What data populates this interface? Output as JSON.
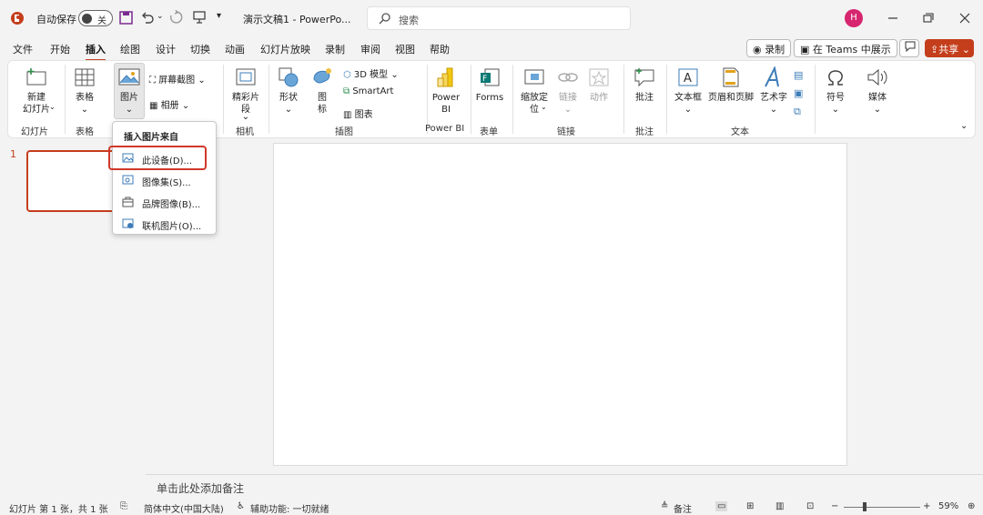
{
  "titlebar": {
    "autosave_label": "自动保存",
    "autosave_state": "关",
    "doc_title": "演示文稿1  -  PowerPo...",
    "search_placeholder": "搜索",
    "avatar_initial": "H"
  },
  "tabs": [
    "文件",
    "开始",
    "插入",
    "绘图",
    "设计",
    "切换",
    "动画",
    "幻灯片放映",
    "录制",
    "审阅",
    "视图",
    "帮助"
  ],
  "active_tab": "插入",
  "header_buttons": {
    "record": "录制",
    "teams": "在 Teams 中展示",
    "share": "共享"
  },
  "ribbon": {
    "new_slide": "新建\n幻灯片",
    "table": "表格",
    "picture": "图片",
    "screenshot": "屏幕截图",
    "album": "相册",
    "cameo": "精彩片\n段",
    "shapes": "形状",
    "icons": "图\n标",
    "model3d": "3D 模型",
    "smartart": "SmartArt",
    "chart": "图表",
    "powerbi": "Power\nBI",
    "forms": "Forms",
    "zoom": "缩放定\n位",
    "link": "链接",
    "action": "动作",
    "comment": "批注",
    "textbox": "文本框",
    "header_footer": "页眉和页脚",
    "wordart": "艺术字",
    "symbol": "符号",
    "media": "媒体",
    "groups": {
      "slides": "幻灯片",
      "tables": "表格",
      "camera": "相机",
      "illustrations": "插图",
      "powerbi": "Power BI",
      "forms": "表单",
      "links": "链接",
      "comments": "批注",
      "text": "文本"
    }
  },
  "dropdown": {
    "header": "插入图片来自",
    "items": [
      "此设备(D)...",
      "图像集(S)...",
      "品牌图像(B)...",
      "联机图片(O)..."
    ]
  },
  "slide_panel": {
    "thumb_number": "1"
  },
  "notes_placeholder": "单击此处添加备注",
  "status": {
    "slide_info": "幻灯片 第 1 张，共 1 张",
    "language": "简体中文(中国大陆)",
    "accessibility": "辅助功能: 一切就绪",
    "notes": "备注",
    "zoom": "59%"
  },
  "colors": {
    "accent": "#c43e1c",
    "avatar": "#d6266f",
    "highlight": "#d0382a"
  }
}
